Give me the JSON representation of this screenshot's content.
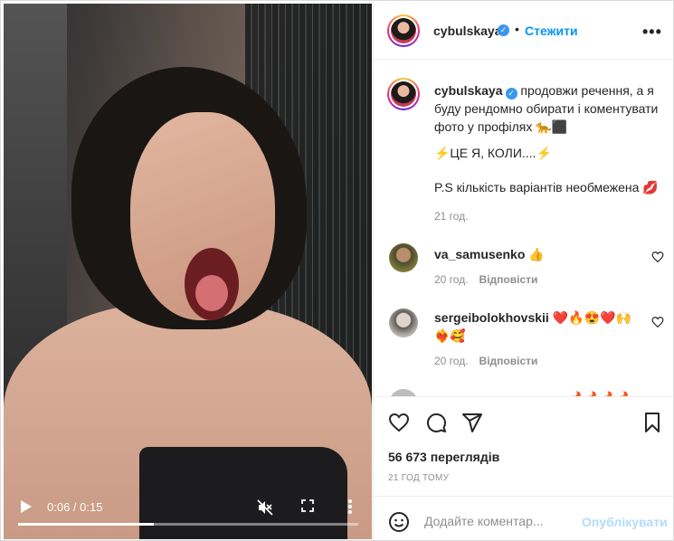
{
  "header": {
    "username": "cybulskaya",
    "separator": "•",
    "follow_label": "Стежити",
    "more_label": "•••"
  },
  "caption": {
    "username": "cybulskaya",
    "text": "продовжи речення, а я буду рендомно обирати і коментувати фото у профілях 🐆⬛",
    "line2": "⚡ЦЕ Я, КОЛИ....⚡",
    "line3": "P.S кількість варіантів необмежена 💋",
    "time": "21 год."
  },
  "comments": [
    {
      "username": "va_samusenko",
      "text": "👍",
      "time": "20 год.",
      "reply_label": "Відповісти"
    },
    {
      "username": "sergeibolokhovskii",
      "text": "❤️🔥😍❤️🙌 ❤️‍🔥🥰",
      "time": "20 год.",
      "reply_label": "Відповісти"
    },
    {
      "username": "",
      "text": "🔥🔥🔥🔥🔥🔥"
    }
  ],
  "actions": {
    "icons": [
      "heart-icon",
      "comment-icon",
      "share-icon",
      "bookmark-icon"
    ],
    "views": "56 673 переглядів",
    "posted": "21 ГОД ТОМУ"
  },
  "add_comment": {
    "placeholder": "Додайте коментар...",
    "publish_label": "Опублікувати"
  },
  "video": {
    "time_display": "0:06 / 0:15",
    "progress": 0.4,
    "muted": true
  },
  "colors": {
    "accent": "#0095f6",
    "verified": "#3897f0",
    "publish_disabled": "#b3dbff",
    "secondary_text": "#8e8e8e"
  }
}
